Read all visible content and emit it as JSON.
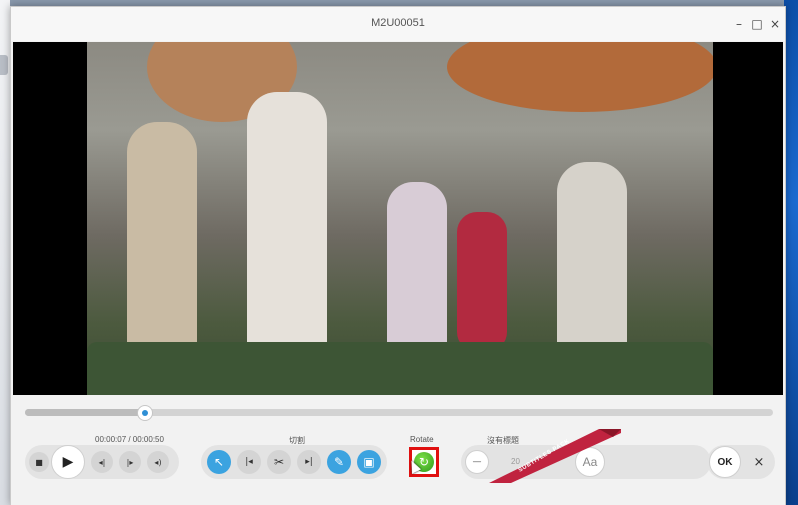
{
  "window": {
    "title": "M2U00051"
  },
  "titlebar": {
    "minimize_glyph": "–",
    "maximize_glyph": "□",
    "close_glyph": "×"
  },
  "player": {
    "time_current": "00:00:07",
    "time_total": "00:00:50",
    "time_display": "00:00:07 / 00:00:50",
    "progress_fraction": 0.16
  },
  "playback_controls": [
    {
      "name": "stop-button",
      "icon": "stop-icon",
      "glyph": "■"
    },
    {
      "name": "play-button",
      "icon": "play-icon",
      "glyph": "▶"
    },
    {
      "name": "prev-frame-button",
      "icon": "prev-frame-icon",
      "glyph": "◂|"
    },
    {
      "name": "next-frame-button",
      "icon": "next-frame-icon",
      "glyph": "|▸"
    },
    {
      "name": "volume-button",
      "icon": "volume-icon",
      "glyph": "◂)"
    }
  ],
  "cut": {
    "label": "切割",
    "tools": [
      {
        "name": "select-tool-button",
        "icon": "cursor-icon",
        "glyph": "↖"
      },
      {
        "name": "mark-in-button",
        "icon": "mark-in-icon",
        "glyph": "|◂"
      },
      {
        "name": "scissors-button",
        "icon": "scissors-icon",
        "glyph": "✂"
      },
      {
        "name": "mark-out-button",
        "icon": "mark-out-icon",
        "glyph": "▸|"
      },
      {
        "name": "edit-tool-button",
        "icon": "pencil-icon",
        "glyph": "✎"
      }
    ]
  },
  "crop": {
    "icon": "crop-frame-icon",
    "glyph": "▣"
  },
  "rotate": {
    "label": "Rotate",
    "icon": "rotate-icon",
    "glyph": "↻"
  },
  "subtitle": {
    "label": "沒有標題",
    "font_size": "20",
    "decrease_glyph": "—",
    "font_glyph": "Aa",
    "ribbon_text": "SUBTITLES PACK"
  },
  "actions": {
    "ok_label": "OK",
    "close_glyph": "×"
  },
  "colors": {
    "accent": "#3ba3e0",
    "highlight": "#e01010",
    "rotate_green": "#3fae22",
    "ribbon": "#c0233f"
  }
}
